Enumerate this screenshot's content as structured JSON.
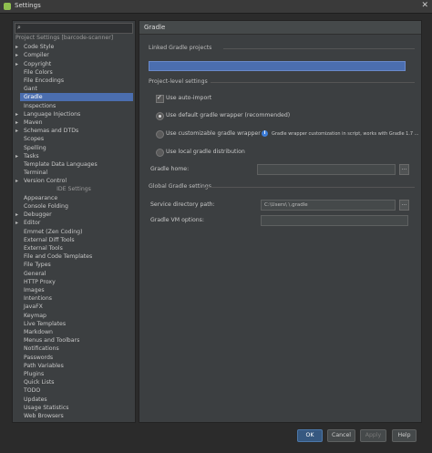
{
  "window": {
    "title": "Settings"
  },
  "sidebar": {
    "search_placeholder": "",
    "project_header": "Project Settings [barcode-scanner]",
    "project_items": [
      {
        "label": "Code Style",
        "arrow": "▸"
      },
      {
        "label": "Compiler",
        "arrow": "▸"
      },
      {
        "label": "Copyright",
        "arrow": "▸"
      },
      {
        "label": "File Colors",
        "arrow": ""
      },
      {
        "label": "File Encodings",
        "arrow": ""
      },
      {
        "label": "Gant",
        "arrow": ""
      },
      {
        "label": "Gradle",
        "arrow": "",
        "selected": true
      },
      {
        "label": "Inspections",
        "arrow": ""
      },
      {
        "label": "Language Injections",
        "arrow": "▸"
      },
      {
        "label": "Maven",
        "arrow": "▸"
      },
      {
        "label": "Schemas and DTDs",
        "arrow": "▸"
      },
      {
        "label": "Scopes",
        "arrow": ""
      },
      {
        "label": "Spelling",
        "arrow": ""
      },
      {
        "label": "Tasks",
        "arrow": "▸"
      },
      {
        "label": "Template Data Languages",
        "arrow": ""
      },
      {
        "label": "Terminal",
        "arrow": ""
      },
      {
        "label": "Version Control",
        "arrow": "▸"
      }
    ],
    "ide_header": "IDE Settings",
    "ide_items": [
      {
        "label": "Appearance",
        "arrow": ""
      },
      {
        "label": "Console Folding",
        "arrow": ""
      },
      {
        "label": "Debugger",
        "arrow": "▸"
      },
      {
        "label": "Editor",
        "arrow": "▸"
      },
      {
        "label": "Emmet (Zen Coding)",
        "arrow": ""
      },
      {
        "label": "External Diff Tools",
        "arrow": ""
      },
      {
        "label": "External Tools",
        "arrow": ""
      },
      {
        "label": "File and Code Templates",
        "arrow": ""
      },
      {
        "label": "File Types",
        "arrow": ""
      },
      {
        "label": "General",
        "arrow": ""
      },
      {
        "label": "HTTP Proxy",
        "arrow": ""
      },
      {
        "label": "Images",
        "arrow": ""
      },
      {
        "label": "Intentions",
        "arrow": ""
      },
      {
        "label": "JavaFX",
        "arrow": ""
      },
      {
        "label": "Keymap",
        "arrow": ""
      },
      {
        "label": "Live Templates",
        "arrow": ""
      },
      {
        "label": "Markdown",
        "arrow": ""
      },
      {
        "label": "Menus and Toolbars",
        "arrow": ""
      },
      {
        "label": "Notifications",
        "arrow": ""
      },
      {
        "label": "Passwords",
        "arrow": ""
      },
      {
        "label": "Path Variables",
        "arrow": ""
      },
      {
        "label": "Plugins",
        "arrow": ""
      },
      {
        "label": "Quick Lists",
        "arrow": ""
      },
      {
        "label": "TODO",
        "arrow": ""
      },
      {
        "label": "Updates",
        "arrow": ""
      },
      {
        "label": "Usage Statistics",
        "arrow": ""
      },
      {
        "label": "Web Browsers",
        "arrow": ""
      }
    ]
  },
  "main": {
    "header": "Gradle",
    "linked_title": "Linked Gradle projects",
    "linked_project": "",
    "project_level_title": "Project-level settings",
    "use_auto_import": "Use auto-import",
    "use_default_wrapper": "Use default gradle wrapper (recommended)",
    "use_custom_wrapper": "Use customizable gradle wrapper",
    "wrapper_note": "Gradle wrapper customization in script, works with Gradle 1.7 ...",
    "use_local": "Use local gradle distribution",
    "gradle_home_label": "Gradle home:",
    "gradle_home_value": "",
    "global_title": "Global Gradle settings",
    "service_dir_label": "Service directory path:",
    "service_dir_value": "C:\\Users\\          \\.gradle",
    "vm_options_label": "Gradle VM options:",
    "vm_options_value": "",
    "browse": "..."
  },
  "footer": {
    "ok": "OK",
    "cancel": "Cancel",
    "apply": "Apply",
    "help": "Help"
  }
}
